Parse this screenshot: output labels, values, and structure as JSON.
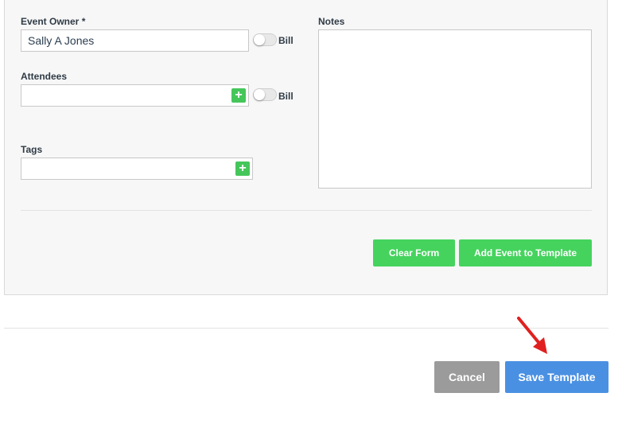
{
  "form": {
    "event_owner_label": "Event Owner *",
    "event_owner_value": "Sally A Jones",
    "bill_label": "Bill",
    "attendees_label": "Attendees",
    "attendees_value": "",
    "tags_label": "Tags",
    "tags_value": "",
    "notes_label": "Notes",
    "notes_value": "",
    "plus_symbol": "+"
  },
  "actions": {
    "clear_form": "Clear Form",
    "add_event": "Add Event to Template",
    "cancel": "Cancel",
    "save_template": "Save Template"
  },
  "colors": {
    "green": "#45d35e",
    "blue": "#4a90e2",
    "gray": "#9b9b9b",
    "arrow": "#e02020"
  }
}
